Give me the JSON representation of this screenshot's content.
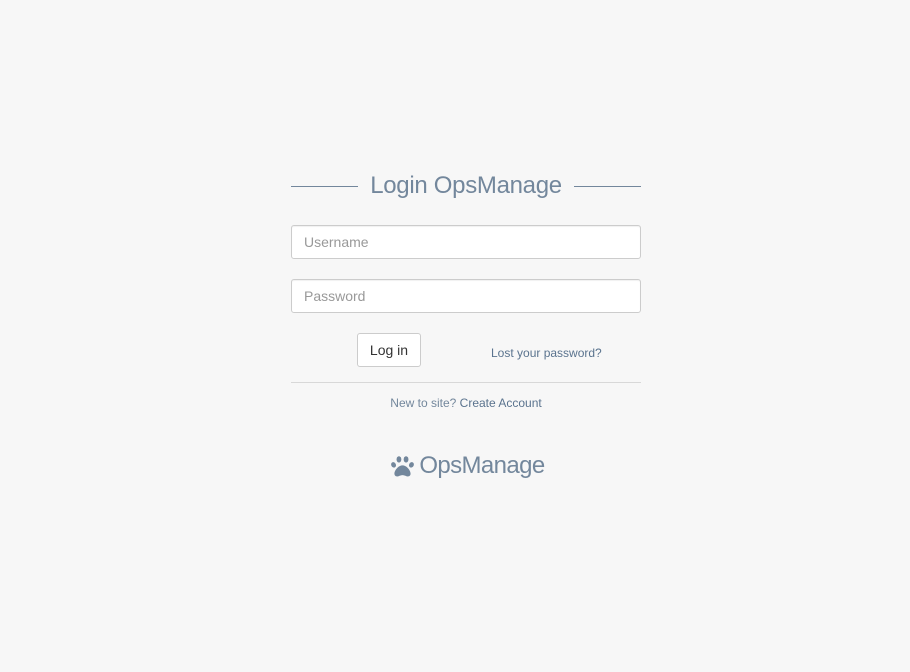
{
  "login": {
    "title": "Login OpsManage",
    "username": {
      "placeholder": "Username",
      "value": ""
    },
    "password": {
      "placeholder": "Password",
      "value": ""
    },
    "login_button": "Log in",
    "lost_password": "Lost your password?",
    "signup_prompt": "New to site?",
    "create_account": "Create Account"
  },
  "brand": {
    "icon": "paw-icon",
    "name": "OpsManage"
  },
  "colors": {
    "background": "#f7f7f7",
    "heading": "#73879c",
    "link": "#5a738e"
  }
}
